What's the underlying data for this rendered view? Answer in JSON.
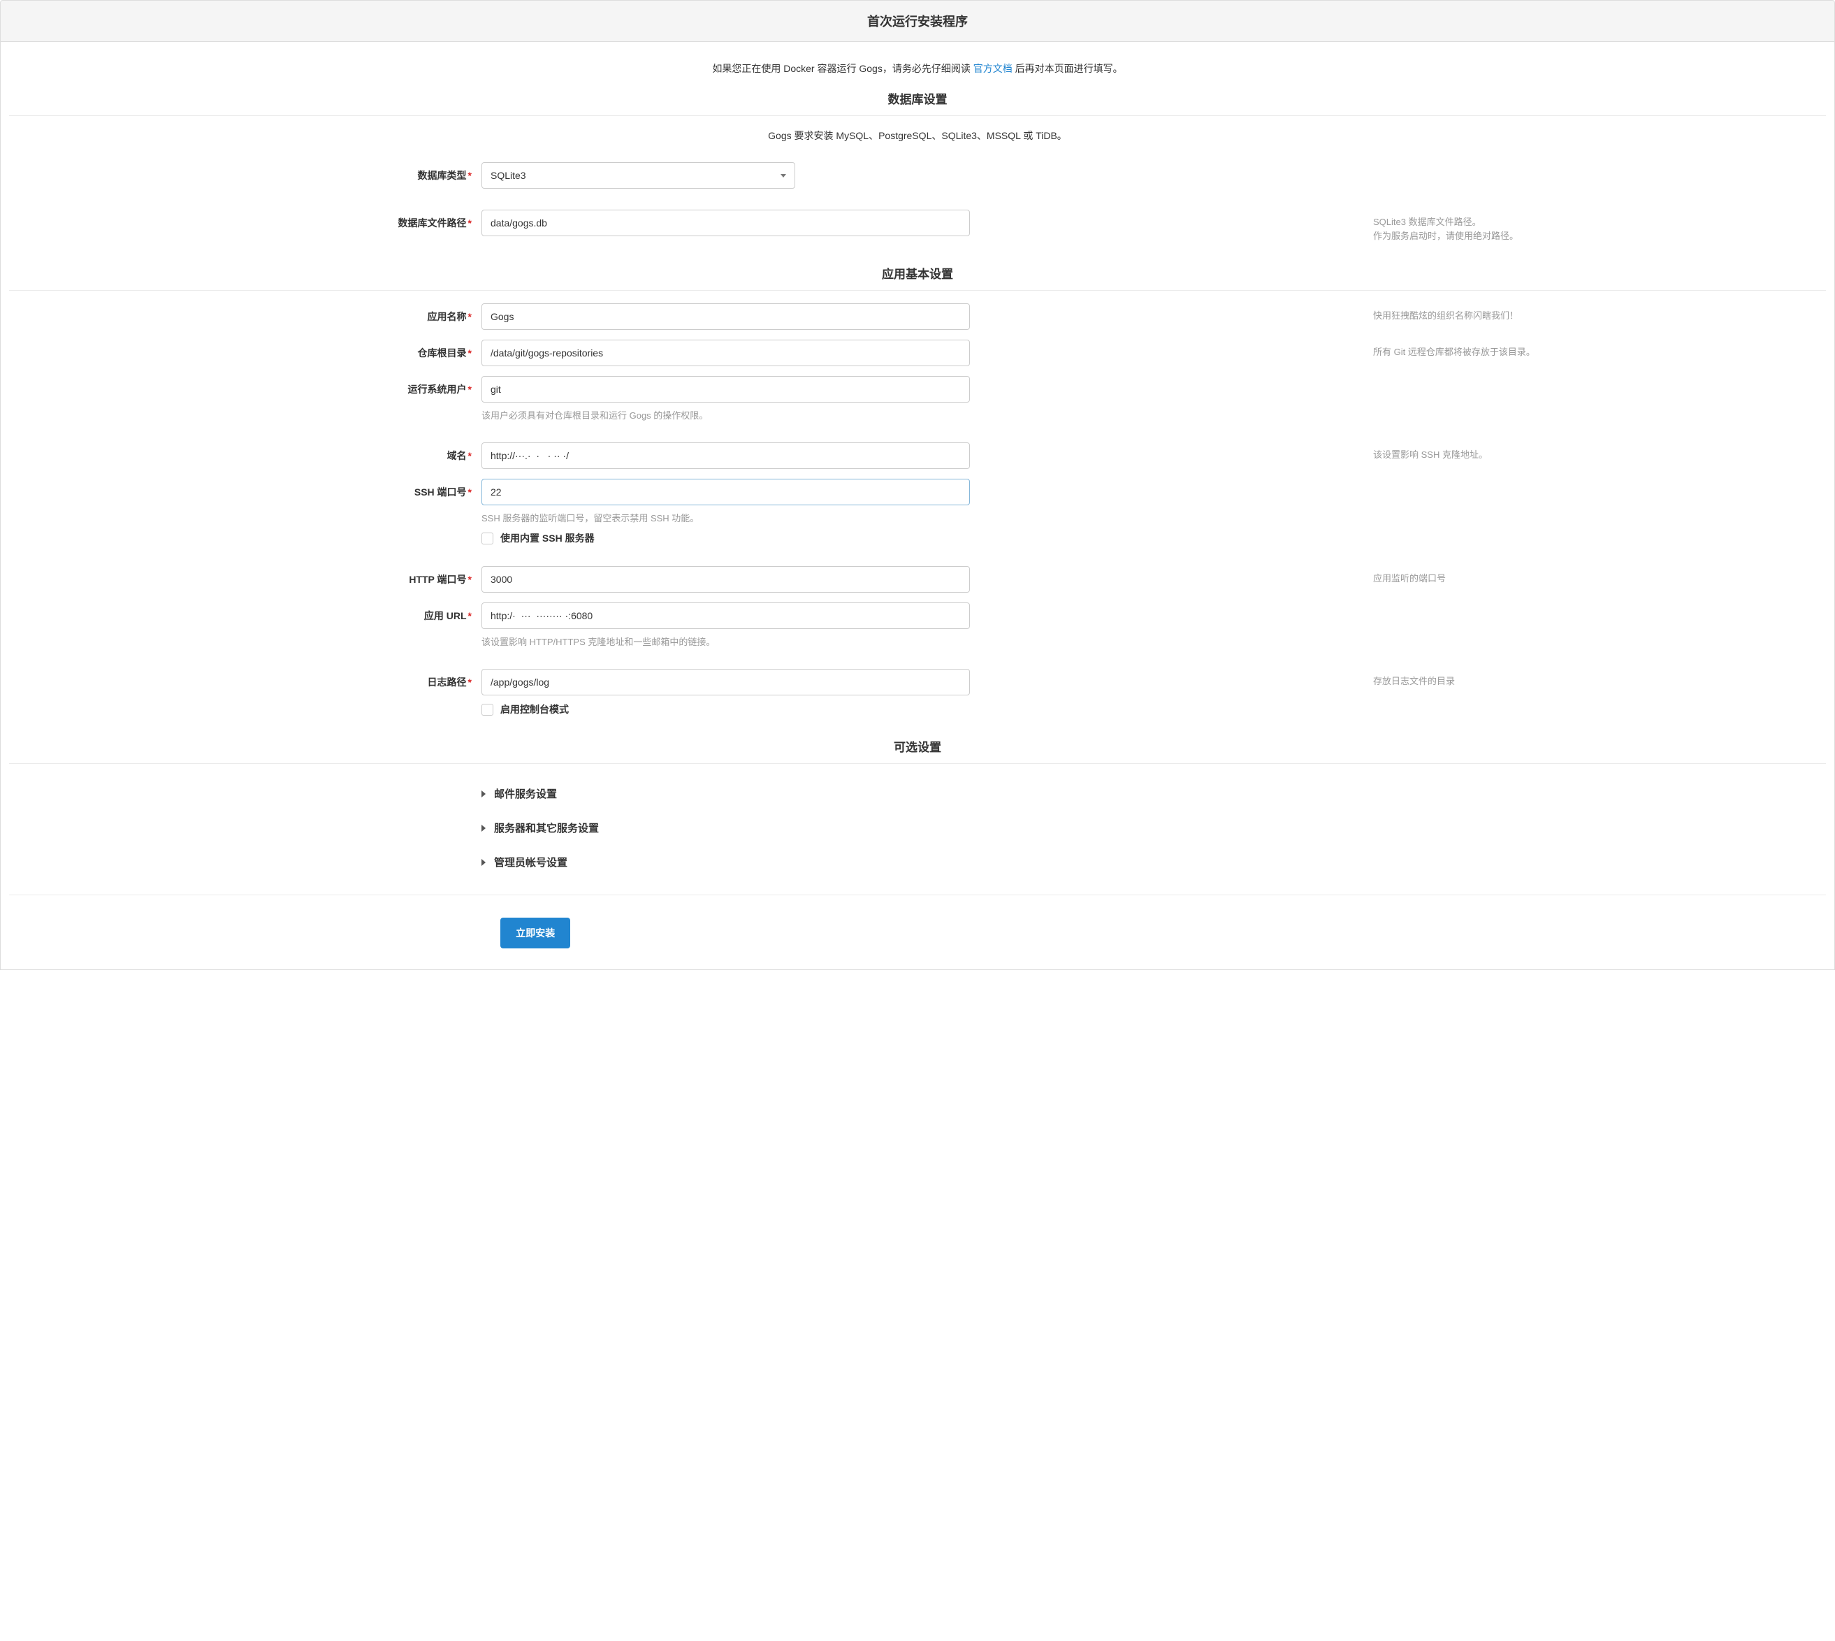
{
  "header": {
    "title": "首次运行安装程序"
  },
  "docker_note": {
    "before": "如果您正在使用 Docker 容器运行 Gogs，请务必先仔细阅读 ",
    "link": "官方文档",
    "after": " 后再对本页面进行填写。"
  },
  "sections": {
    "db": {
      "title": "数据库设置",
      "note": "Gogs 要求安装 MySQL、PostgreSQL、SQLite3、MSSQL 或 TiDB。",
      "fields": {
        "type": {
          "label": "数据库类型",
          "value": "SQLite3"
        },
        "path": {
          "label": "数据库文件路径",
          "value": "data/gogs.db",
          "help1": "SQLite3 数据库文件路径。",
          "help2": "作为服务启动时，请使用绝对路径。"
        }
      }
    },
    "app": {
      "title": "应用基本设置",
      "fields": {
        "name": {
          "label": "应用名称",
          "value": "Gogs",
          "help": "快用狂拽酷炫的组织名称闪瞎我们！"
        },
        "repo_root": {
          "label": "仓库根目录",
          "value": "/data/git/gogs-repositories",
          "help": "所有 Git 远程仓库都将被存放于该目录。"
        },
        "run_user": {
          "label": "运行系统用户",
          "value": "git",
          "hint": "该用户必须具有对仓库根目录和运行 Gogs 的操作权限。"
        },
        "domain": {
          "label": "域名",
          "value": "http://···.·  ·   · ·· ·/",
          "help": "该设置影响 SSH 克隆地址。"
        },
        "ssh_port": {
          "label": "SSH 端口号",
          "value": "22",
          "hint": "SSH 服务器的监听端口号，留空表示禁用 SSH 功能。",
          "checkbox": "使用内置 SSH 服务器"
        },
        "http_port": {
          "label": "HTTP 端口号",
          "value": "3000",
          "help": "应用监听的端口号"
        },
        "app_url": {
          "label": "应用 URL",
          "value": "http:/·  ···  ········ ·:6080",
          "hint": "该设置影响 HTTP/HTTPS 克隆地址和一些邮箱中的链接。"
        },
        "log_path": {
          "label": "日志路径",
          "value": "/app/gogs/log",
          "help": "存放日志文件的目录",
          "checkbox": "启用控制台模式"
        }
      }
    },
    "optional": {
      "title": "可选设置",
      "items": [
        "邮件服务设置",
        "服务器和其它服务设置",
        "管理员帐号设置"
      ]
    }
  },
  "install_button": "立即安装"
}
